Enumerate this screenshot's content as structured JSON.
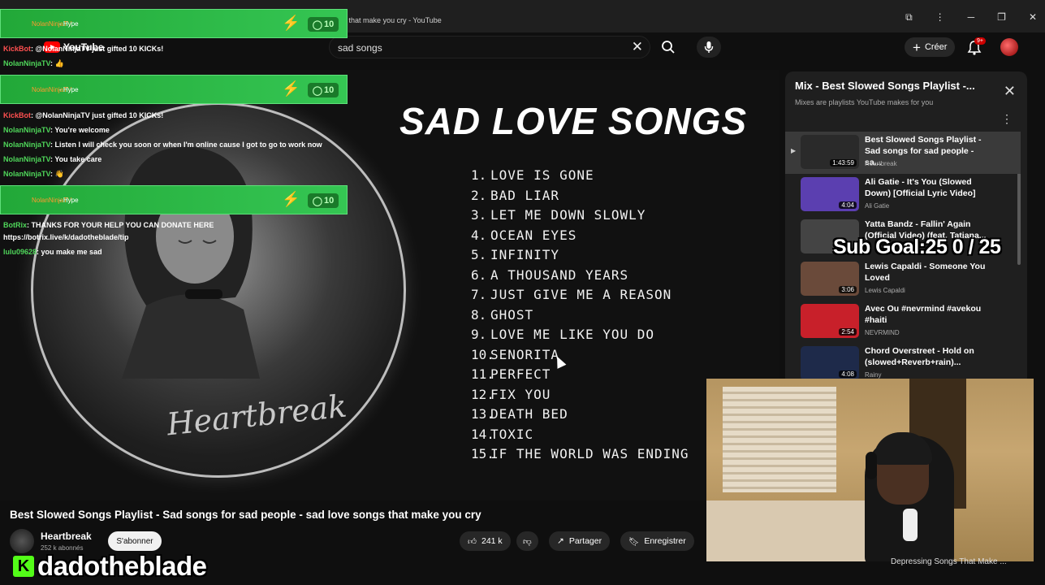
{
  "browser": {
    "tab_title": "YouTube - (2703) Best Slowed Songs Playlist - Sad songs for sad people - sad love songs that make you cry - YouTube"
  },
  "youtube": {
    "logo_text": "YouTube",
    "search_query": "sad songs",
    "create_label": "Créer",
    "notif_count": "9+"
  },
  "player": {
    "headline": "SAD LOVE SONGS",
    "signature": "Heartbreak",
    "songs": [
      {
        "n": "1.",
        "t": "LOVE IS GONE"
      },
      {
        "n": "2.",
        "t": "BAD LIAR"
      },
      {
        "n": "3.",
        "t": "LET ME DOWN SLOWLY"
      },
      {
        "n": "4.",
        "t": "OCEAN EYES"
      },
      {
        "n": "5.",
        "t": "INFINITY"
      },
      {
        "n": "6.",
        "t": "A THOUSAND YEARS"
      },
      {
        "n": "7.",
        "t": "JUST GIVE ME A REASON"
      },
      {
        "n": "8.",
        "t": "GHOST"
      },
      {
        "n": "9.",
        "t": "LOVE ME LIKE YOU DO"
      },
      {
        "n": "10.",
        "t": "SENORITA"
      },
      {
        "n": "11.",
        "t": "PERFECT"
      },
      {
        "n": "12.",
        "t": "FIX YOU"
      },
      {
        "n": "13.",
        "t": "DEATH BED"
      },
      {
        "n": "14.",
        "t": "TOXIC"
      },
      {
        "n": "15.",
        "t": "IF THE WORLD WAS ENDING"
      }
    ]
  },
  "video": {
    "title": "Best Slowed Songs Playlist - Sad songs for sad people - sad love songs that make you cry",
    "channel": "Heartbreak",
    "subscribers": "252 k abonnés",
    "subscribe_label": "S'abonner",
    "likes": "241 k",
    "share_label": "Partager",
    "save_label": "Enregistrer"
  },
  "mix": {
    "title": "Mix - Best Slowed Songs Playlist -...",
    "subtitle": "Mixes are playlists YouTube makes for you",
    "items": [
      {
        "title": "Best Slowed Songs Playlist - Sad songs for sad people - sa...",
        "channel": "Heartbreak",
        "duration": "1:43:59",
        "color": "#2a2a2a"
      },
      {
        "title": "Ali Gatie - It's You (Slowed Down) [Official Lyric Video]",
        "channel": "Ali Gatie",
        "duration": "4:04",
        "color": "#5b3fb0"
      },
      {
        "title": "Yatta Bandz - Fallin' Again (Official Video) (feat. Tatiana...",
        "channel": "",
        "duration": "",
        "color": "#444444"
      },
      {
        "title": "Lewis Capaldi - Someone You Loved",
        "channel": "Lewis Capaldi",
        "duration": "3:06",
        "color": "#6a4a3a"
      },
      {
        "title": "Avec Ou #nevrmind #avekou #haiti",
        "channel": "NEVRMIND",
        "duration": "2:54",
        "color": "#c8202a"
      },
      {
        "title": "Chord Overstreet - Hold on (slowed+Reverb+rain)...",
        "channel": "Rainy",
        "duration": "4:08",
        "color": "#1e2a4a"
      }
    ],
    "peek_title": "Depressing Songs That Make ..."
  },
  "overlay": {
    "chat": [
      {
        "user": "NolanNinjaTV",
        "msg": ": Hype",
        "kind": "hype-top"
      },
      {
        "user": "KickBot",
        "msg": ": @NolanNinjaTV just gifted 10 KICKs!",
        "kind": "line"
      },
      {
        "user": "NolanNinjaTV",
        "msg": ": 👍",
        "kind": "line"
      },
      {
        "user": "KickBot",
        "msg": ": @NolanNinjaTV just gifted 10 KICKs!",
        "kind": "line"
      },
      {
        "user": "NolanNinjaTV",
        "msg": ": You're welcome",
        "kind": "line"
      },
      {
        "user": "NolanNinjaTV",
        "msg": ": Listen I will check you soon or when I'm online cause I got to go to work now",
        "kind": "line"
      },
      {
        "user": "NolanNinjaTV",
        "msg": ": You take care",
        "kind": "line"
      },
      {
        "user": "NolanNinjaTV",
        "msg": ": 👋",
        "kind": "line"
      },
      {
        "user": "BotRix",
        "msg": ": THANKS FOR YOUR HELP YOU CAN DONATE HERE",
        "kind": "line"
      },
      {
        "user": "",
        "msg": "https://botrix.live/k/dadotheblade/tip",
        "kind": "line"
      },
      {
        "user": "lulu09628",
        "msg": ": you make me sad",
        "kind": "line"
      }
    ],
    "hype_name": "NolanNinjaTV",
    "hype_suffix": "- Hype",
    "hype_count": "10",
    "sub_goal": "Sub Goal:25  0 / 25",
    "streamer": "dadotheblade",
    "kick_logo": "K"
  },
  "colors": {
    "hype_green": "#35c653",
    "kick_green": "#53fc18",
    "yt_red": "#ff0000"
  }
}
